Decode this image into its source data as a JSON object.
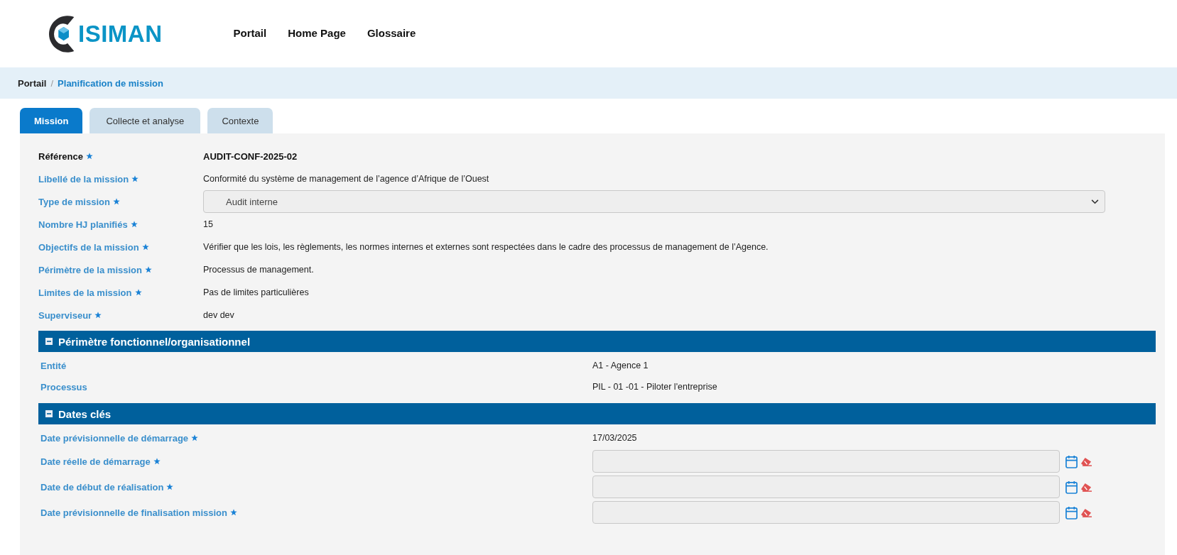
{
  "header": {
    "logo_text": "ISIMAN",
    "nav": [
      {
        "label": "Portail"
      },
      {
        "label": "Home Page"
      },
      {
        "label": "Glossaire"
      }
    ]
  },
  "breadcrumb": {
    "separator": "/",
    "items": [
      {
        "label": "Portail",
        "current": false
      },
      {
        "label": "Planification de mission",
        "current": true
      }
    ]
  },
  "tabs": [
    {
      "label": "Mission",
      "selected": true
    },
    {
      "label": "Collecte et analyse",
      "selected": false
    },
    {
      "label": "Contexte",
      "selected": false
    }
  ],
  "fields": [
    {
      "kind": "primary",
      "label": "Référence",
      "required": true,
      "value": "AUDIT-CONF-2025-02"
    },
    {
      "kind": "text",
      "label": "Libellé de la mission",
      "required": true,
      "value": "Conformité du système de management de l’agence d’Afrique de l’Ouest"
    },
    {
      "kind": "select",
      "label": "Type de mission",
      "required": true,
      "value": "Audit interne"
    },
    {
      "kind": "text",
      "label": "Nombre HJ planifiés",
      "required": true,
      "value": "15"
    },
    {
      "kind": "text",
      "label": "Objectifs de la mission",
      "required": true,
      "value": "Vérifier que les lois, les règlements, les normes internes et externes sont respectées dans le cadre des processus de management de l’Agence."
    },
    {
      "kind": "text",
      "label": "Périmètre de la mission",
      "required": true,
      "value": "Processus de management."
    },
    {
      "kind": "text",
      "label": "Limites de la mission",
      "required": true,
      "value": "Pas de limites particulières"
    },
    {
      "kind": "text",
      "label": "Superviseur",
      "required": true,
      "value": "dev dev"
    }
  ],
  "sections": [
    {
      "title": "Périmètre fonctionnel/organisationnel",
      "expanded": true,
      "rows": [
        {
          "kind": "text",
          "label": "Entité",
          "required": false,
          "value": "A1 - Agence 1"
        },
        {
          "kind": "text",
          "label": "Processus",
          "required": false,
          "value": "PIL - 01 -01 - Piloter l'entreprise"
        }
      ]
    },
    {
      "title": "Dates clés",
      "expanded": true,
      "rows": [
        {
          "kind": "text",
          "label": "Date prévisionnelle de démarrage",
          "required": true,
          "value": "17/03/2025"
        },
        {
          "kind": "date",
          "label": "Date réelle de démarrage",
          "required": true
        },
        {
          "kind": "date",
          "label": "Date de début de réalisation",
          "required": true
        },
        {
          "kind": "date",
          "label": "Date prévisionnelle de finalisation mission",
          "required": true
        }
      ]
    }
  ]
}
